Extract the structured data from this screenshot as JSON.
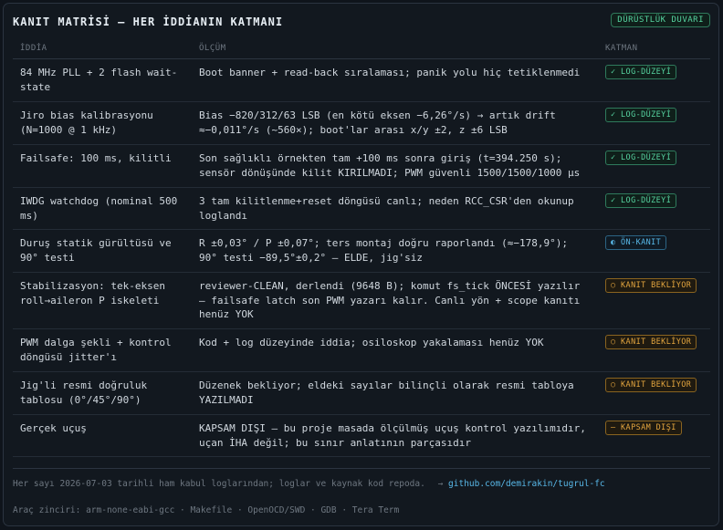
{
  "header": {
    "title": "KANIT MATRİSİ — HER İDDİANIN KATMANI",
    "badge": "DÜRÜSTLÜK DUVARI"
  },
  "columns": {
    "claim": "İDDİA",
    "measurement": "ÖLÇÜM",
    "layer": "KATMAN"
  },
  "rows": [
    {
      "claim": "84 MHz PLL + 2 flash wait-state",
      "measurement": "Boot banner + read-back sıralaması; panik yolu hiç tetiklenmedi",
      "layer": "✓ LOG-DÜZEYİ",
      "status": "green"
    },
    {
      "claim": "Jiro bias kalibrasyonu (N=1000 @ 1 kHz)",
      "measurement": "Bias −820/312/63 LSB (en kötü eksen −6,26°/s) → artık drift ≈−0,011°/s (~560×); boot'lar arası x/y ±2, z ±6 LSB",
      "layer": "✓ LOG-DÜZEYİ",
      "status": "green"
    },
    {
      "claim": "Failsafe: 100 ms, kilitli",
      "measurement": "Son sağlıklı örnekten tam +100 ms sonra giriş (t=394.250 s); sensör dönüşünde kilit KIRILMADI; PWM güvenli 1500/1500/1000 µs",
      "layer": "✓ LOG-DÜZEYİ",
      "status": "green"
    },
    {
      "claim": "IWDG watchdog (nominal 500 ms)",
      "measurement": "3 tam kilitlenme+reset döngüsü canlı; neden RCC_CSR'den okunup loglandı",
      "layer": "✓ LOG-DÜZEYİ",
      "status": "green"
    },
    {
      "claim": "Duruş statik gürültüsü ve 90° testi",
      "measurement": "R ±0,03° / P ±0,07°; ters montaj doğru raporlandı (≈−178,9°); 90° testi −89,5°±0,2° — ELDE, jig'siz",
      "layer": "◐ ÖN-KANIT",
      "status": "blue"
    },
    {
      "claim": "Stabilizasyon: tek-eksen roll→aileron P iskeleti",
      "measurement": "reviewer-CLEAN, derlendi (9648 B); komut fs_tick ÖNCESİ yazılır — failsafe latch son PWM yazarı kalır. Canlı yön + scope kanıtı henüz YOK",
      "layer": "○ KANIT BEKLİYOR",
      "status": "amber"
    },
    {
      "claim": "PWM dalga şekli + kontrol döngüsü jitter'ı",
      "measurement": "Kod + log düzeyinde iddia; osiloskop yakalaması henüz YOK",
      "layer": "○ KANIT BEKLİYOR",
      "status": "amber"
    },
    {
      "claim": "Jig'li resmi doğruluk tablosu (0°/45°/90°)",
      "measurement": "Düzenek bekliyor; eldeki sayılar bilinçli olarak resmi tabloya YAZILMADI",
      "layer": "○ KANIT BEKLİYOR",
      "status": "amber"
    },
    {
      "claim": "Gerçek uçuş",
      "measurement": "KAPSAM DIŞI — bu proje masada ölçülmüş uçuş kontrol yazılımıdır, uçan İHA değil; bu sınır anlatının parçasıdır",
      "layer": "— KAPSAM DIŞI",
      "status": "amber"
    }
  ],
  "footer": {
    "note": "Her sayı 2026-07-03 tarihli ham kabul loglarından; loglar ve kaynak kod repoda.",
    "arrow": "→",
    "link": "github.com/demirakin/tugrul-fc",
    "toolchain": "Araç zinciri: arm-none-eabi-gcc · Makefile · OpenOCD/SWD · GDB · Tera Term"
  },
  "colors": {
    "green": "#56d3a0",
    "blue": "#58b8e8",
    "amber": "#e3a53f"
  }
}
